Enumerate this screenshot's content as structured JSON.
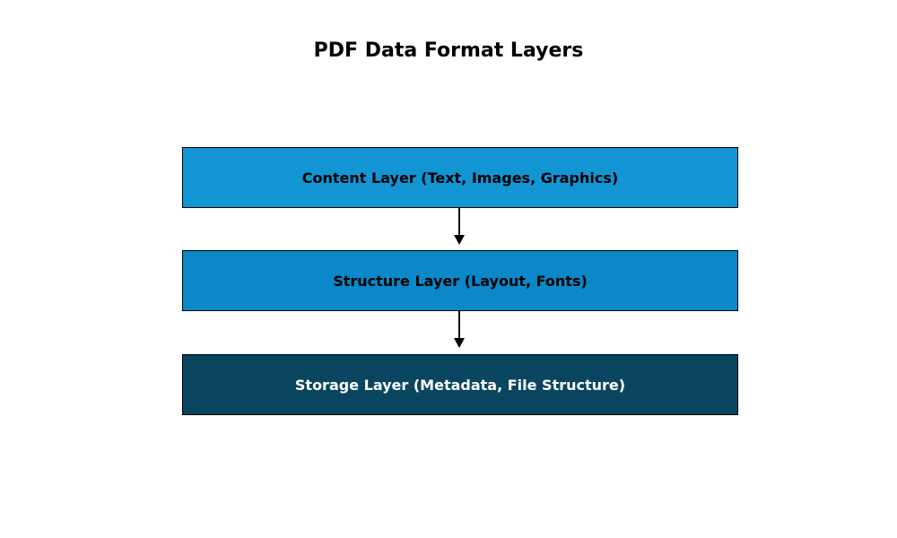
{
  "title": "PDF Data Format Layers",
  "layers": [
    {
      "label": "Content Layer (Text, Images, Graphics)"
    },
    {
      "label": "Structure Layer (Layout, Fonts)"
    },
    {
      "label": "Storage Layer (Metadata, File Structure)"
    }
  ],
  "colors": {
    "layer_top": "#1295d2",
    "layer_mid": "#0a88c8",
    "layer_bot": "#0a4560",
    "border": "#000000",
    "bot_text": "#ffffff"
  }
}
